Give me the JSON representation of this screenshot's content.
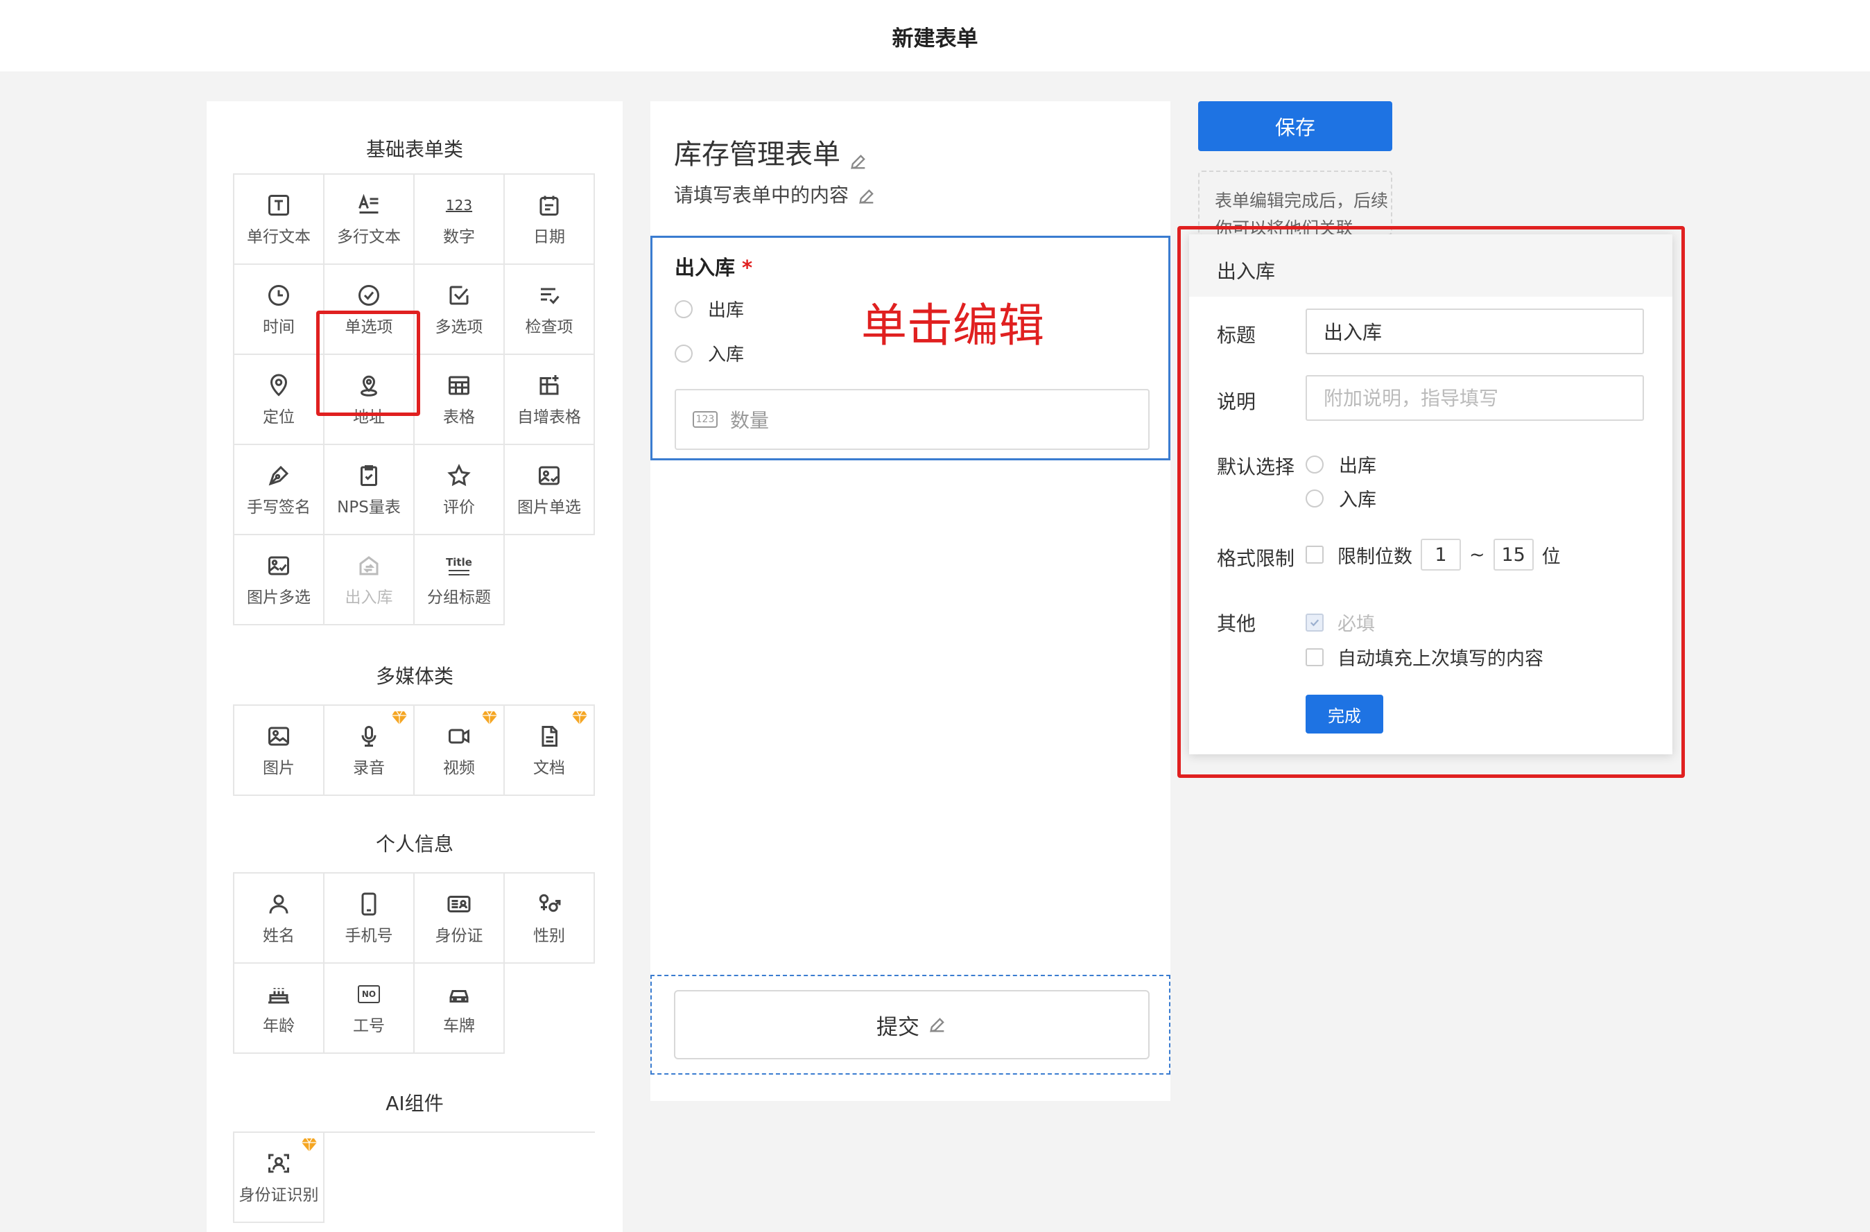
{
  "header": {
    "title": "新建表单"
  },
  "palette": {
    "sections": [
      {
        "title": "基础表单类"
      },
      {
        "title": "多媒体类"
      },
      {
        "title": "个人信息"
      },
      {
        "title": "AI组件"
      }
    ],
    "basic": [
      "单行文本",
      "多行文本",
      "数字",
      "日期",
      "时间",
      "单选项",
      "多选项",
      "检查项",
      "定位",
      "地址",
      "表格",
      "自增表格",
      "手写签名",
      "NPS量表",
      "评价",
      "图片单选",
      "图片多选",
      "出入库",
      "分组标题"
    ],
    "media": [
      "图片",
      "录音",
      "视频",
      "文档"
    ],
    "personal": [
      "姓名",
      "手机号",
      "身份证",
      "性别",
      "年龄",
      "工号",
      "车牌"
    ],
    "ai": [
      "身份证识别"
    ],
    "icon_glyphs": {
      "number": "123",
      "title": "Title",
      "no": "NO"
    },
    "gem_color": "#f5a623"
  },
  "form": {
    "title": "库存管理表单",
    "description": "请填写表单中的内容",
    "field": {
      "name": "出入库",
      "required_mark": "*",
      "options": [
        "出库",
        "入库"
      ],
      "quantity_icon": "123",
      "quantity_placeholder": "数量"
    },
    "submit_label": "提交"
  },
  "annotation": "单击编辑",
  "right": {
    "save_label": "保存",
    "tip": "表单编辑完成后，后续你可以将他们关联"
  },
  "properties": {
    "header": "出入库",
    "title_label": "标题",
    "title_value": "出入库",
    "desc_label": "说明",
    "desc_placeholder": "附加说明，指导填写",
    "default_label": "默认选择",
    "default_options": [
      "出库",
      "入库"
    ],
    "format_label": "格式限制",
    "limit_digits_label": "限制位数",
    "limit_min": "1",
    "limit_sep": "~",
    "limit_max": "15",
    "limit_unit": "位",
    "other_label": "其他",
    "required_label": "必填",
    "autofill_label": "自动填充上次填写的内容",
    "done_label": "完成"
  },
  "colors": {
    "accent": "#1e73e3",
    "annotation": "#e02020",
    "field_border": "#3a7cd0"
  }
}
